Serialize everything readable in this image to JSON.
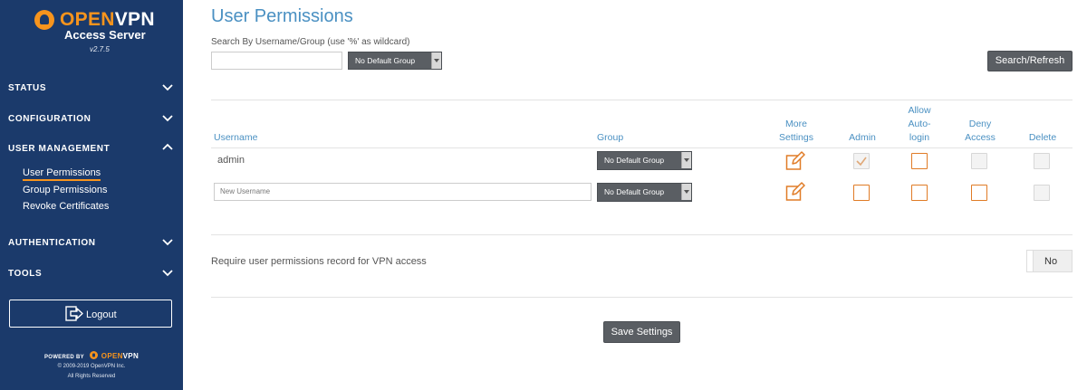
{
  "sidebar": {
    "brand": {
      "open": "OPEN",
      "vpn": "VPN",
      "subtitle": "Access Server",
      "version": "v2.7.5"
    },
    "nav": [
      {
        "label": "STATUS",
        "expanded": false
      },
      {
        "label": "CONFIGURATION",
        "expanded": false
      },
      {
        "label": "USER MANAGEMENT",
        "expanded": true
      },
      {
        "label": "AUTHENTICATION",
        "expanded": false
      },
      {
        "label": "TOOLS",
        "expanded": false
      }
    ],
    "user_management_items": [
      {
        "label": "User Permissions",
        "active": true
      },
      {
        "label": "Group Permissions",
        "active": false
      },
      {
        "label": "Revoke Certificates",
        "active": false
      }
    ],
    "logout_label": "Logout",
    "powered_by": "POWERED BY",
    "powered_brand_open": "OPEN",
    "powered_brand_vpn": "VPN",
    "copyright": "© 2009-2019 OpenVPN Inc.",
    "rights": "All Rights Reserved"
  },
  "main": {
    "title": "User Permissions",
    "search": {
      "label": "Search By Username/Group (use '%' as wildcard)",
      "value": "",
      "group_select": "No Default Group",
      "button_label": "Search/Refresh"
    },
    "table": {
      "headers": {
        "username": "Username",
        "group": "Group",
        "more_settings_1": "More",
        "more_settings_2": "Settings",
        "admin": "Admin",
        "allow_1": "Allow",
        "allow_2": "Auto-",
        "allow_3": "login",
        "deny_1": "Deny",
        "deny_2": "Access",
        "delete": "Delete"
      },
      "rows": [
        {
          "username": "admin",
          "group": "No Default Group",
          "admin": true,
          "allow_auto_login": false,
          "deny_access": false,
          "delete": false
        },
        {
          "username_placeholder": "New Username",
          "group": "No Default Group",
          "admin": false,
          "allow_auto_login": false,
          "deny_access": false,
          "delete": false
        }
      ]
    },
    "require_permissions": {
      "label": "Require user permissions record for VPN access",
      "toggle_value": "No"
    },
    "save_label": "Save Settings"
  },
  "colors": {
    "sidebar_bg": "#1b3a6b",
    "accent": "#f7941d",
    "header_blue": "#4a90c2",
    "button_gray": "#5a5e63",
    "checkbox_orange": "#e07b26"
  }
}
